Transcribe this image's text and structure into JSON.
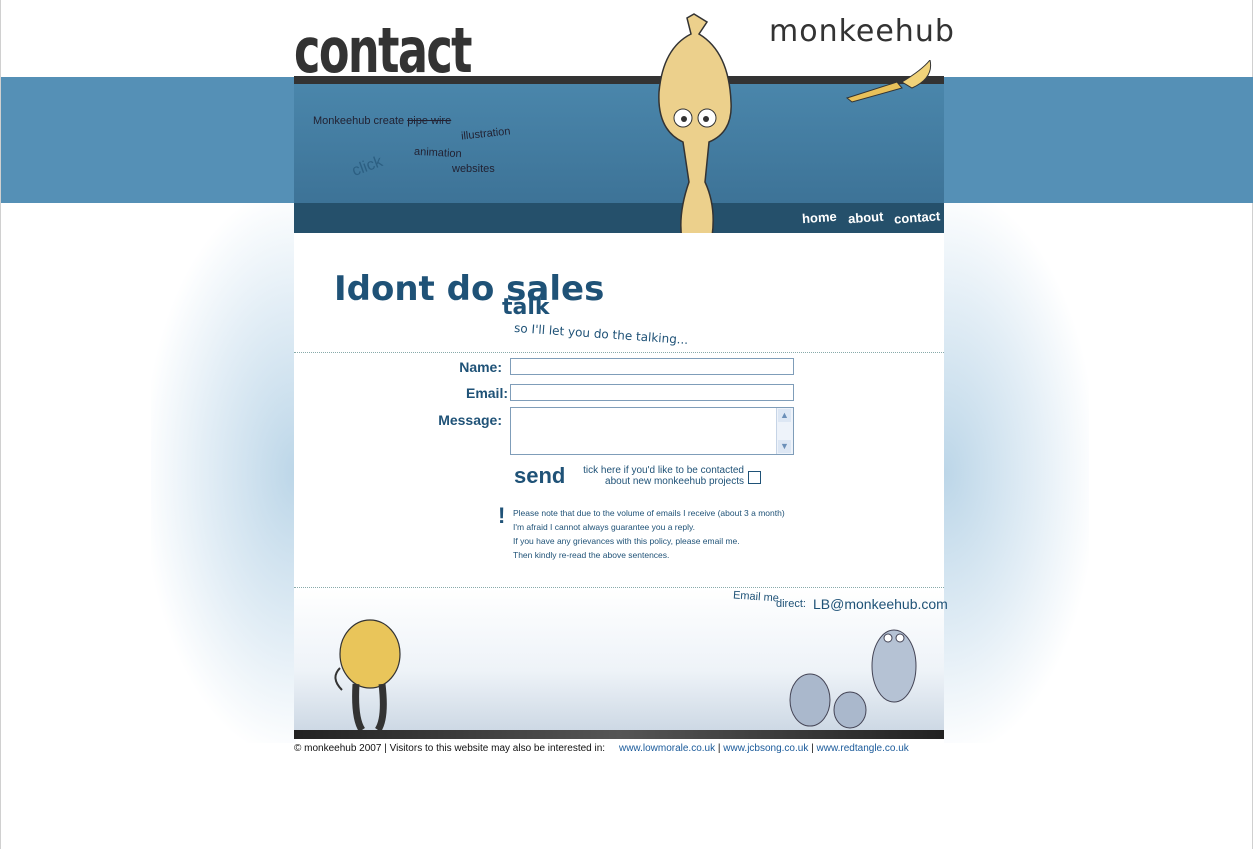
{
  "header": {
    "title": "contact",
    "logo": "monkeehub"
  },
  "banner": {
    "tagline_prefix": "Monkeehub create",
    "tagline_struck": "pipe wire",
    "tags": [
      "illustration",
      "animation",
      "websites"
    ],
    "click": "click"
  },
  "nav": {
    "home": "home",
    "about": "about",
    "contact": "contact"
  },
  "intro": {
    "headline": "Idont do sales",
    "headline_talk": "talk",
    "subline": "so I'll let you do the talking..."
  },
  "form": {
    "name_label": "Name:",
    "email_label": "Email:",
    "message_label": "Message:",
    "name_value": "",
    "email_value": "",
    "message_value": "",
    "send_label": "send",
    "tick_line1": "tick here if you'd like to be contacted",
    "tick_line2": "about new monkeehub projects",
    "tick_checked": false
  },
  "notice": {
    "mark": "!",
    "lines": [
      "Please note that due to the volume of emails I receive  (about 3 a month)",
      "I'm afraid I cannot always guarantee you a reply.",
      "If you have any grievances with this policy, please email me.",
      "Then kindly re-read the above sentences."
    ]
  },
  "direct": {
    "label": "Email me",
    "label2": "direct:",
    "address": "LB@monkeehub.com"
  },
  "footer": {
    "copyright": "© monkeehub 2007 | Visitors to this website may also be interested in:",
    "links": [
      "www.lowmorale.co.uk",
      "www.jcbsong.co.uk",
      "www.redtangle.co.uk"
    ]
  },
  "colors": {
    "band": "#5590b6",
    "nav": "#25506b",
    "text": "#1f5277"
  }
}
